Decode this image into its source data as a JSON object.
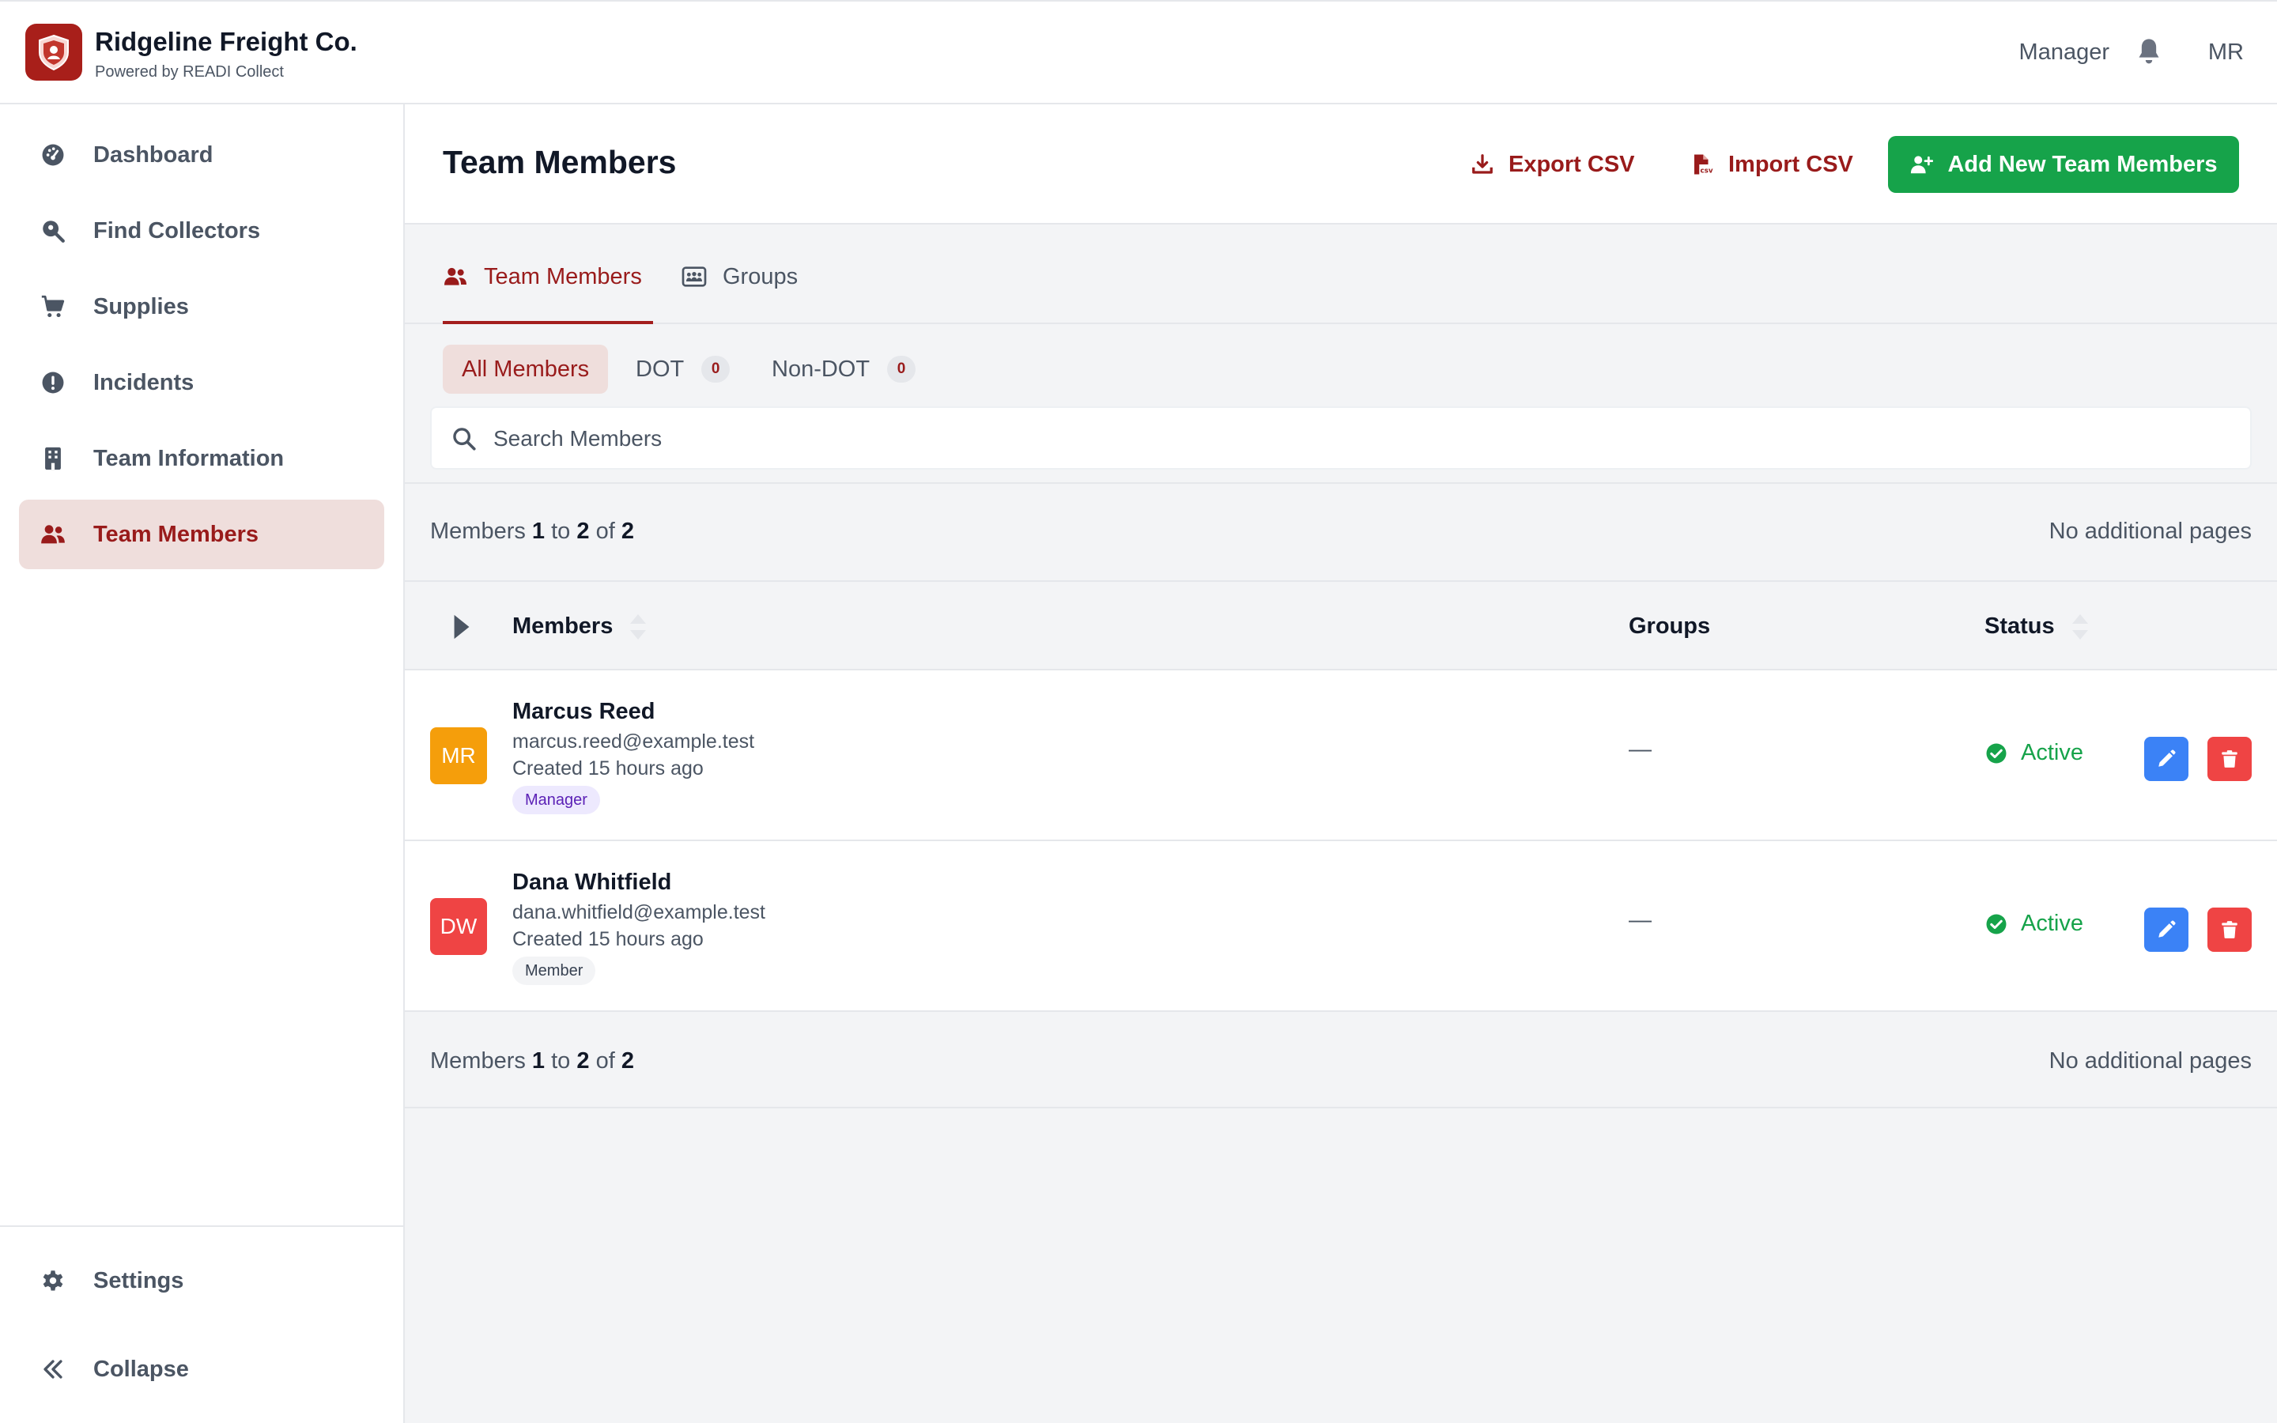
{
  "brand": {
    "name": "Ridgeline Freight Co.",
    "powered_by": "Powered by READI Collect"
  },
  "topbar": {
    "role": "Manager",
    "user_initials": "MR"
  },
  "sidebar": {
    "items": [
      {
        "label": "Dashboard",
        "icon": "gauge-icon"
      },
      {
        "label": "Find Collectors",
        "icon": "search-location-icon"
      },
      {
        "label": "Supplies",
        "icon": "cart-icon"
      },
      {
        "label": "Incidents",
        "icon": "exclamation-circle-icon"
      },
      {
        "label": "Team Information",
        "icon": "building-icon"
      },
      {
        "label": "Team Members",
        "icon": "users-icon",
        "active": true
      }
    ],
    "bottom": [
      {
        "label": "Settings",
        "icon": "gear-icon"
      },
      {
        "label": "Collapse",
        "icon": "double-chevron-left-icon"
      }
    ]
  },
  "page": {
    "title": "Team Members",
    "export_label": "Export CSV",
    "import_label": "Import CSV",
    "add_label": "Add New Team Members"
  },
  "tabs": [
    {
      "label": "Team Members",
      "active": true
    },
    {
      "label": "Groups",
      "active": false
    }
  ],
  "filters": [
    {
      "label": "All Members",
      "active": true
    },
    {
      "label": "DOT",
      "count": "0"
    },
    {
      "label": "Non-DOT",
      "count": "0"
    }
  ],
  "search": {
    "placeholder": "Search Members"
  },
  "pager": {
    "prefix": "Members",
    "from": "1",
    "to_word": "to",
    "to": "2",
    "of_word": "of",
    "total": "2",
    "note": "No additional pages"
  },
  "table": {
    "columns": {
      "members": "Members",
      "groups": "Groups",
      "status": "Status"
    },
    "rows": [
      {
        "initials": "MR",
        "avatar_color": "#f59e0b",
        "name": "Marcus Reed",
        "email": "marcus.reed@example.test",
        "created": "Created 15 hours ago",
        "role": "Manager",
        "groups": "—",
        "status": "Active"
      },
      {
        "initials": "DW",
        "avatar_color": "#ef4444",
        "name": "Dana Whitfield",
        "email": "dana.whitfield@example.test",
        "created": "Created 15 hours ago",
        "role": "Member",
        "groups": "—",
        "status": "Active"
      }
    ]
  },
  "colors": {
    "brand": "#a81f1a",
    "accent_text": "#991b1b",
    "primary_button": "#16a34a",
    "status_active": "#16a34a",
    "edit_button": "#3b82f6",
    "delete_button": "#ef4444"
  }
}
